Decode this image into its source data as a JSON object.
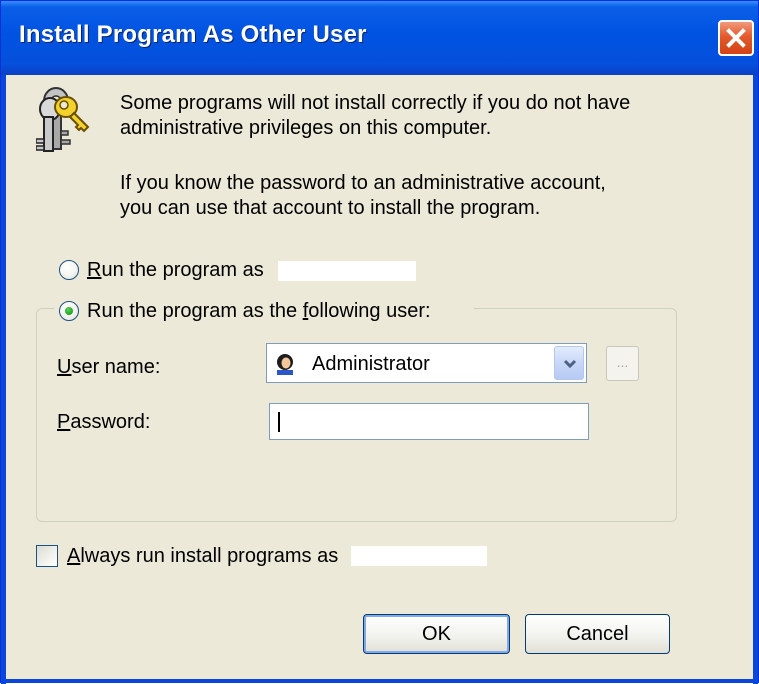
{
  "window": {
    "title": "Install Program As Other User"
  },
  "message": {
    "line1": "Some programs will not install correctly if you do not have",
    "line2": "administrative privileges on this computer.",
    "line3": "If you know the password to an administrative account,",
    "line4": "you can use that account to install the program."
  },
  "options": {
    "run_as_current": {
      "accel": "R",
      "rest": "un the program as",
      "selected": false
    },
    "run_as_following": {
      "pre": "Run the program as the ",
      "accel": "f",
      "post": "ollowing user:",
      "selected": true
    }
  },
  "fields": {
    "username_label_accel": "U",
    "username_label_rest": "ser name:",
    "username_value": "Administrator",
    "browse_label": "...",
    "password_label_accel": "P",
    "password_label_rest": "assword:",
    "password_value": ""
  },
  "always_run": {
    "accel": "A",
    "rest": "lways run install programs as",
    "checked": false
  },
  "buttons": {
    "ok": "OK",
    "cancel": "Cancel"
  },
  "colors": {
    "titlebar": "#0053e1",
    "close": "#e25a2d",
    "dialog_bg": "#ece9d8",
    "radio_selected": "#21a121"
  },
  "icons": {
    "header": "keys-icon",
    "user": "user-icon",
    "close": "close-icon",
    "dropdown": "chevron-down-icon"
  }
}
